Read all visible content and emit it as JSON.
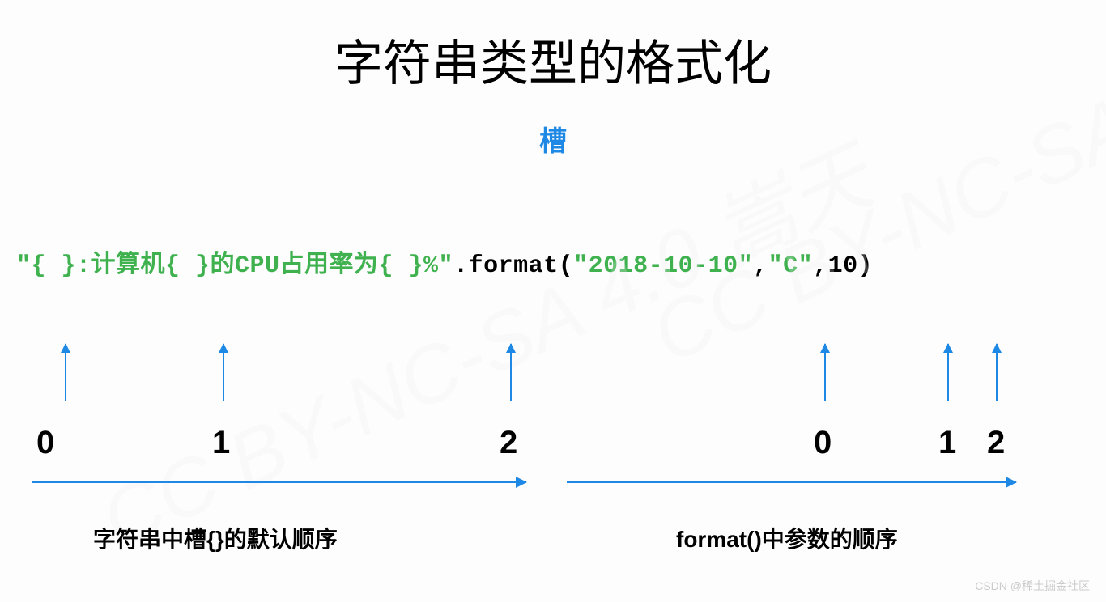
{
  "title": "字符串类型的格式化",
  "subtitle": "槽",
  "code": {
    "part1": "\"{ }:",
    "part2": "计算机",
    "part3": "{ }",
    "part4": "的CPU占用率为",
    "part5": "{ }%\"",
    "part6": ".format(",
    "part7": "\"2018-10-10\"",
    "part8": ",",
    "part9": "\"C\"",
    "part10": ",10)"
  },
  "left_indices": [
    "0",
    "1",
    "2"
  ],
  "right_indices": [
    "0",
    "1",
    "2"
  ],
  "left_caption": "字符串中槽{}的默认顺序",
  "right_caption": "format()中参数的顺序",
  "watermark_text": "CSDN @稀土掘金社区",
  "bg_watermark": "CC BY-NC-SA 4.0 嵩天"
}
